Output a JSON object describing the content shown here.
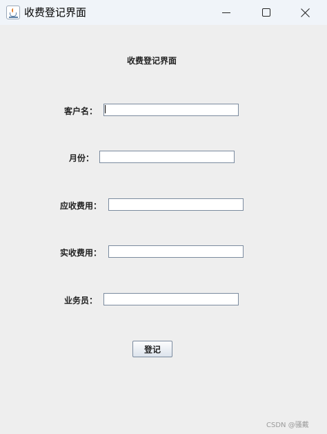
{
  "window": {
    "title": "收费登记界面",
    "controls": {
      "minimize": "minimize",
      "maximize": "maximize",
      "close": "close"
    }
  },
  "form": {
    "heading": "收费登记界面",
    "fields": [
      {
        "label": "客户名：",
        "value": ""
      },
      {
        "label": "月份：",
        "value": ""
      },
      {
        "label": "应收费用：",
        "value": ""
      },
      {
        "label": "实收费用：",
        "value": ""
      },
      {
        "label": "业务员：",
        "value": ""
      }
    ],
    "submit_label": "登记"
  },
  "watermark": "CSDN @骚戴"
}
